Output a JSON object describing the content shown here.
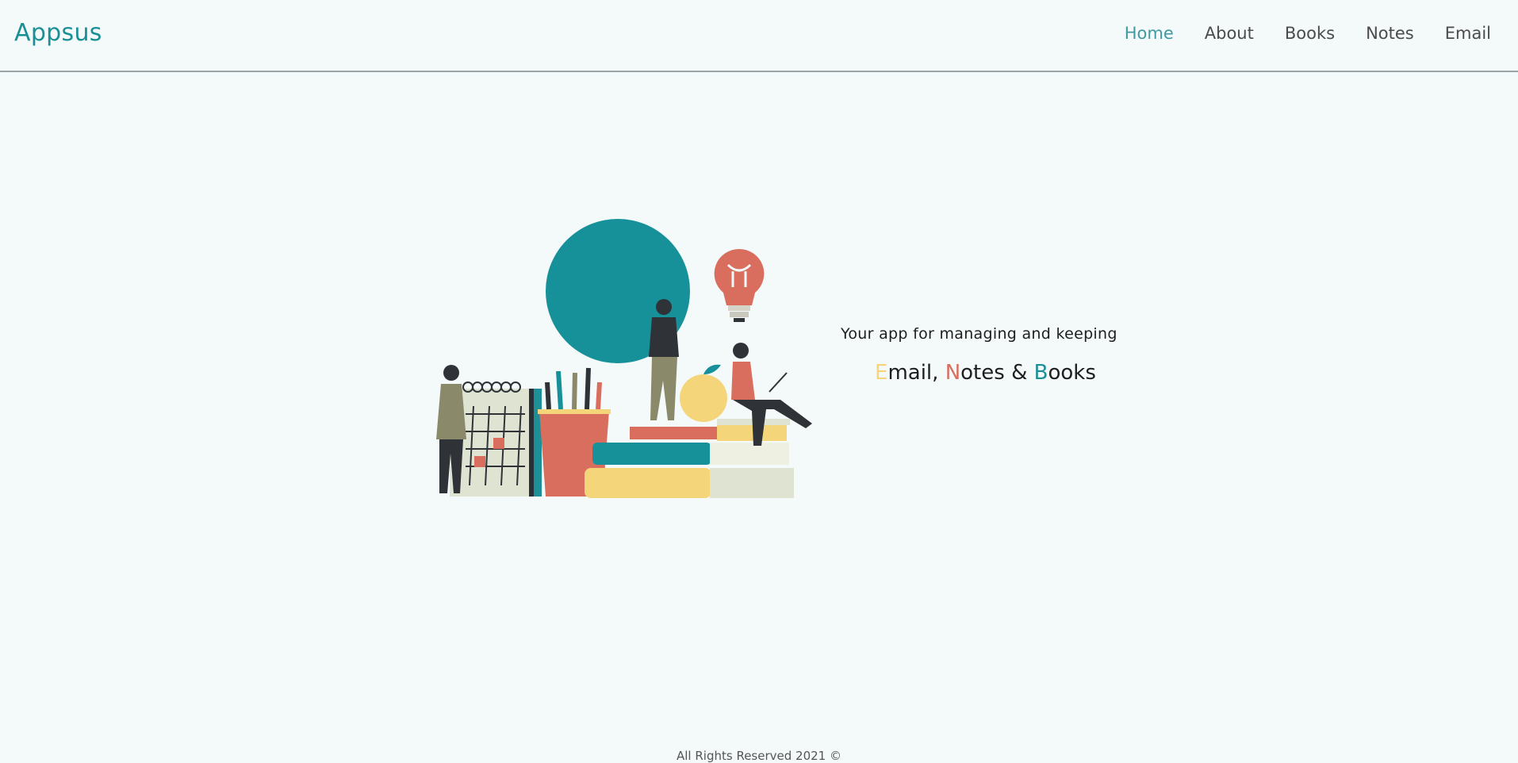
{
  "header": {
    "logo": "Appsus",
    "nav": [
      {
        "label": "Home",
        "active": true
      },
      {
        "label": "About",
        "active": false
      },
      {
        "label": "Books",
        "active": false
      },
      {
        "label": "Notes",
        "active": false
      },
      {
        "label": "Email",
        "active": false
      }
    ]
  },
  "hero": {
    "tagline": "Your app for managing and keeping",
    "apps": {
      "email_initial": "E",
      "email_rest": "mail,",
      "notes_initial": "N",
      "notes_rest": "otes",
      "amp": "&",
      "books_initial": "B",
      "books_rest": "ooks"
    },
    "illustration": "study-illustration"
  },
  "footer": {
    "text": "All Rights Reserved 2021 ©"
  },
  "colors": {
    "brand": "#1a8f96",
    "nav_active": "#3f9aa0",
    "accent_yellow": "#f5d57a",
    "accent_red": "#d96e5e",
    "background": "#f4f9fa"
  }
}
